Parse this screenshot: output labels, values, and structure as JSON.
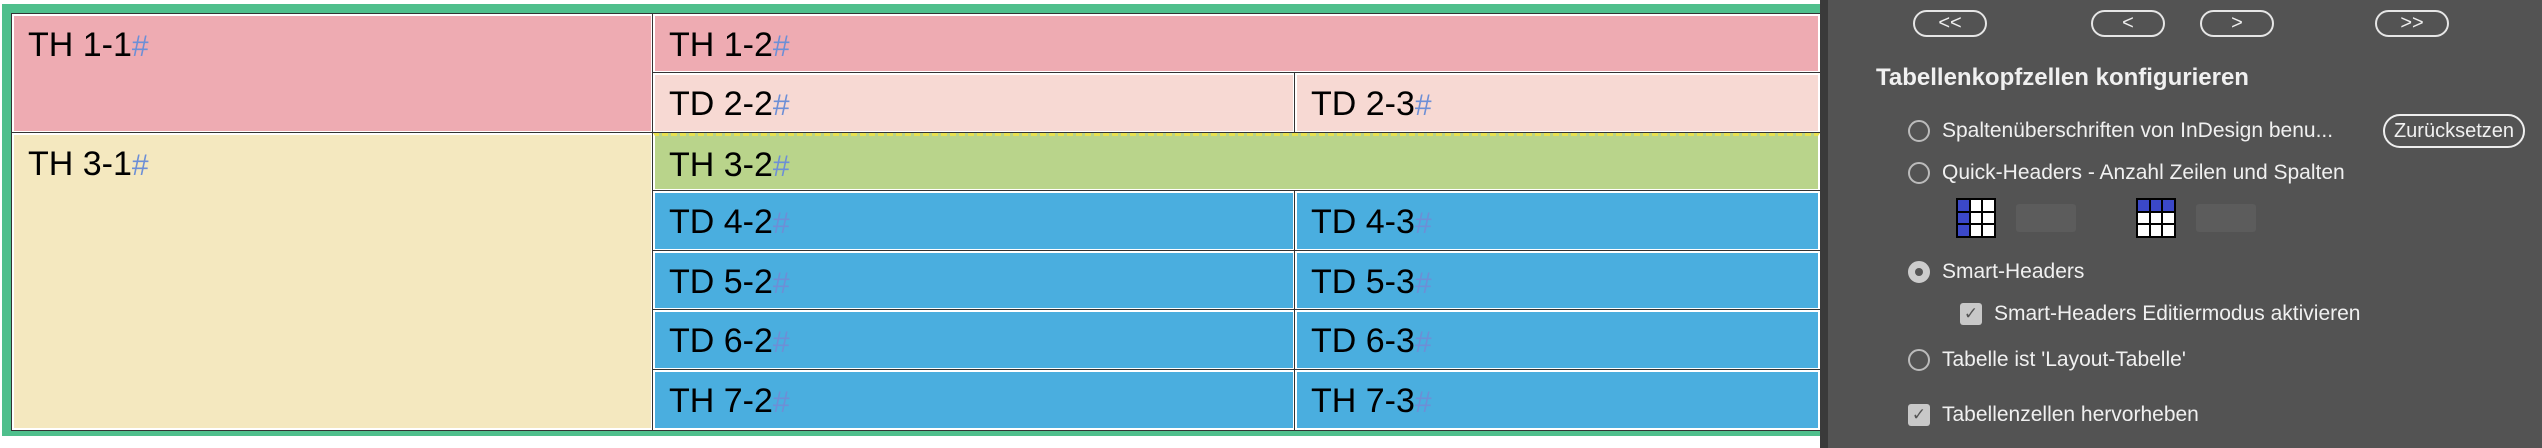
{
  "table": {
    "cells": {
      "th11": "TH 1-1",
      "th12": "TH 1-2",
      "td22": "TD 2-2",
      "td23": "TD 2-3",
      "th31": "TH 3-1",
      "th32": "TH 3-2",
      "td42": "TD 4-2",
      "td43": "TD 4-3",
      "td52": "TD 5-2",
      "td53": "TD 5-3",
      "td62": "TD 6-2",
      "td63": "TD 6-3",
      "th72": "TH 7-2",
      "th73": "TH 7-3"
    },
    "colors": {
      "th_pink": "#eeabb2",
      "td_pink": "#f7d9d3",
      "th_yellow": "#f4e8bf",
      "th_green": "#b9d48b",
      "td_blue": "#4aaedf",
      "frame": "#4fbf8c"
    }
  },
  "panel": {
    "nav": {
      "first": "<<",
      "prev": "<",
      "next": ">",
      "last": ">>"
    },
    "title": "Tabellenkopfzellen konfigurieren",
    "options": {
      "indesign": "Spaltenüberschriften von InDesign benu...",
      "reset": "Zurücksetzen",
      "quick": "Quick-Headers - Anzahl Zeilen und Spalten",
      "smart": "Smart-Headers",
      "smart_edit": "Smart-Headers Editiermodus aktivieren",
      "layout": "Tabelle ist 'Layout-Tabelle'",
      "highlight": "Tabellenzellen hervorheben"
    },
    "state": {
      "selected_radio": "smart",
      "smart_edit_checked": true,
      "highlight_checked": true
    }
  }
}
